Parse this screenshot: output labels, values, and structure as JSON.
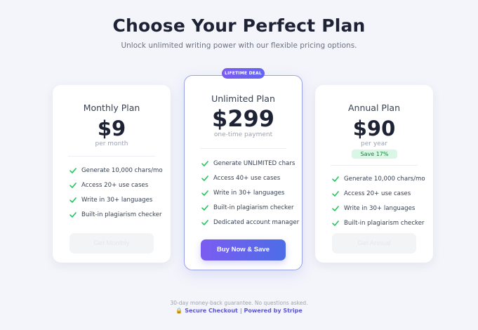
{
  "header": {
    "title": "Choose Your Perfect Plan",
    "subtitle": "Unlock unlimited writing power with our flexible pricing options."
  },
  "plans": [
    {
      "name": "Monthly Plan",
      "price": "$9",
      "period": "per month",
      "features": [
        "Generate 10,000 chars/mo",
        "Access 20+ use cases",
        "Write in 30+ languages",
        "Built-in plagiarism checker"
      ],
      "button_label": "Get Monthly"
    },
    {
      "badge": "LIFETIME DEAL",
      "name": "Unlimited Plan",
      "price": "$299",
      "period": "one-time payment",
      "features": [
        "Generate UNLIMITED chars",
        "Access 40+ use cases",
        "Write in 30+ languages",
        "Built-in plagiarism checker",
        "Dedicated account manager"
      ],
      "button_label": "Buy Now & Save"
    },
    {
      "name": "Annual Plan",
      "price": "$90",
      "period": "per year",
      "save_label": "Save 17%",
      "features": [
        "Generate 10,000 chars/mo",
        "Access 20+ use cases",
        "Write in 30+ languages",
        "Built-in plagiarism checker"
      ],
      "button_label": "Get Annual"
    }
  ],
  "footer": {
    "guarantee": "30-day money-back guarantee. No questions asked.",
    "lock_icon": "lock-icon",
    "secure_checkout": "Secure Checkout",
    "separator": "|",
    "powered_by": "Powered by Stripe"
  },
  "colors": {
    "accent": "#6366f1",
    "check": "#22c55e",
    "save_bg": "#d9f7e4",
    "save_text": "#16803c"
  }
}
